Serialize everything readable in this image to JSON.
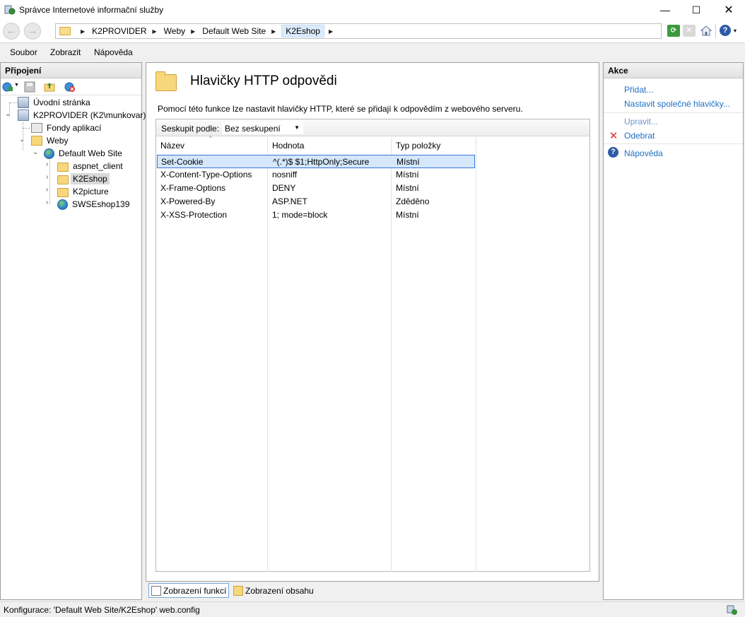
{
  "window": {
    "title": "Správce Internetové informační služby",
    "min": "—",
    "max": "☐",
    "close": "✕"
  },
  "nav": {
    "back": "←",
    "forward": "→",
    "breadcrumb": [
      "K2PROVIDER",
      "Weby",
      "Default Web Site",
      "K2Eshop"
    ],
    "sep": "▶",
    "help_dropdown": "▾"
  },
  "menu": {
    "file": "Soubor",
    "view": "Zobrazit",
    "help": "Nápověda"
  },
  "connections": {
    "title": "Připojení",
    "tree": [
      {
        "label": "Úvodní stránka",
        "icon": "start-page-icon"
      },
      {
        "label": "K2PROVIDER (K2\\munkovar)",
        "icon": "server-icon"
      },
      {
        "label": "Fondy aplikací",
        "icon": "application-pools-icon"
      },
      {
        "label": "Weby",
        "icon": "sites-icon"
      },
      {
        "label": "Default Web Site",
        "icon": "globe-icon"
      },
      {
        "label": "aspnet_client",
        "icon": "folder-icon"
      },
      {
        "label": "K2Eshop",
        "icon": "folder-icon"
      },
      {
        "label": "K2picture",
        "icon": "folder-icon"
      },
      {
        "label": "SWSEshop139",
        "icon": "globe-icon"
      }
    ]
  },
  "main": {
    "title": "Hlavičky HTTP odpovědi",
    "description": "Pomocí této funkce lze nastavit hlavičky HTTP, které se přidají k odpovědím z webového serveru.",
    "group_by_label": "Seskupit podle:",
    "group_by_value": "Bez seskupení",
    "columns": [
      "Název",
      "Hodnota",
      "Typ položky"
    ],
    "rows": [
      {
        "name": "Set-Cookie",
        "value": "^(.*)$ $1;HttpOnly;Secure",
        "type": "Místní"
      },
      {
        "name": "X-Content-Type-Options",
        "value": "nosniff",
        "type": "Místní"
      },
      {
        "name": "X-Frame-Options",
        "value": "DENY",
        "type": "Místní"
      },
      {
        "name": "X-Powered-By",
        "value": "ASP.NET",
        "type": "Zděděno"
      },
      {
        "name": "X-XSS-Protection",
        "value": "1; mode=block",
        "type": "Místní"
      }
    ],
    "selected_row": 0
  },
  "view_tabs": {
    "features": "Zobrazení funkcí",
    "content": "Zobrazení obsahu"
  },
  "actions": {
    "title": "Akce",
    "add": "Přidat...",
    "set_common": "Nastavit společné hlavičky...",
    "edit": "Upravit...",
    "remove": "Odebrat",
    "help": "Nápověda"
  },
  "status": {
    "text": "Konfigurace: 'Default Web Site/K2Eshop' web.config"
  },
  "colors": {
    "link": "#1e6fc4",
    "remove_icon": "#d9302c",
    "selection": "#d5e7fb"
  }
}
